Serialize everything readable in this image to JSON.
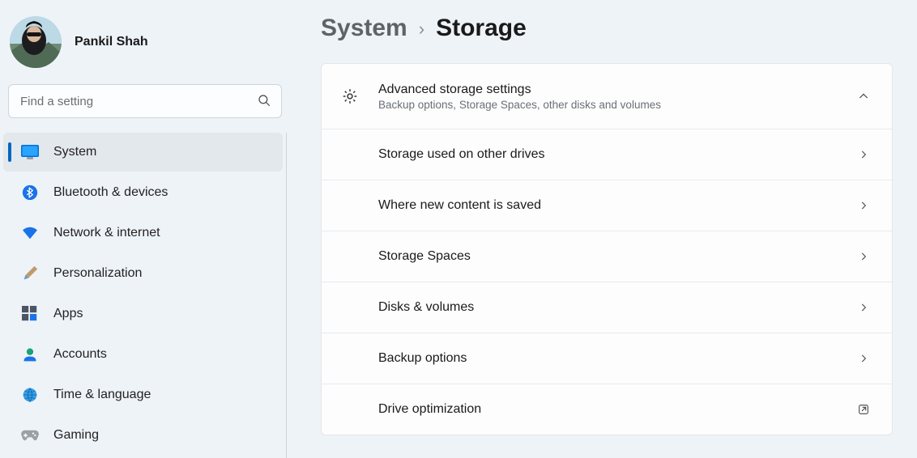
{
  "profile": {
    "name": "Pankil Shah"
  },
  "search": {
    "placeholder": "Find a setting"
  },
  "sidebar": {
    "items": [
      {
        "label": "System"
      },
      {
        "label": "Bluetooth & devices"
      },
      {
        "label": "Network & internet"
      },
      {
        "label": "Personalization"
      },
      {
        "label": "Apps"
      },
      {
        "label": "Accounts"
      },
      {
        "label": "Time & language"
      },
      {
        "label": "Gaming"
      }
    ]
  },
  "breadcrumb": {
    "parent": "System",
    "current": "Storage"
  },
  "panel": {
    "header": {
      "title": "Advanced storage settings",
      "subtitle": "Backup options, Storage Spaces, other disks and volumes"
    },
    "rows": [
      {
        "label": "Storage used on other drives"
      },
      {
        "label": "Where new content is saved"
      },
      {
        "label": "Storage Spaces"
      },
      {
        "label": "Disks & volumes"
      },
      {
        "label": "Backup options"
      },
      {
        "label": "Drive optimization"
      }
    ]
  }
}
